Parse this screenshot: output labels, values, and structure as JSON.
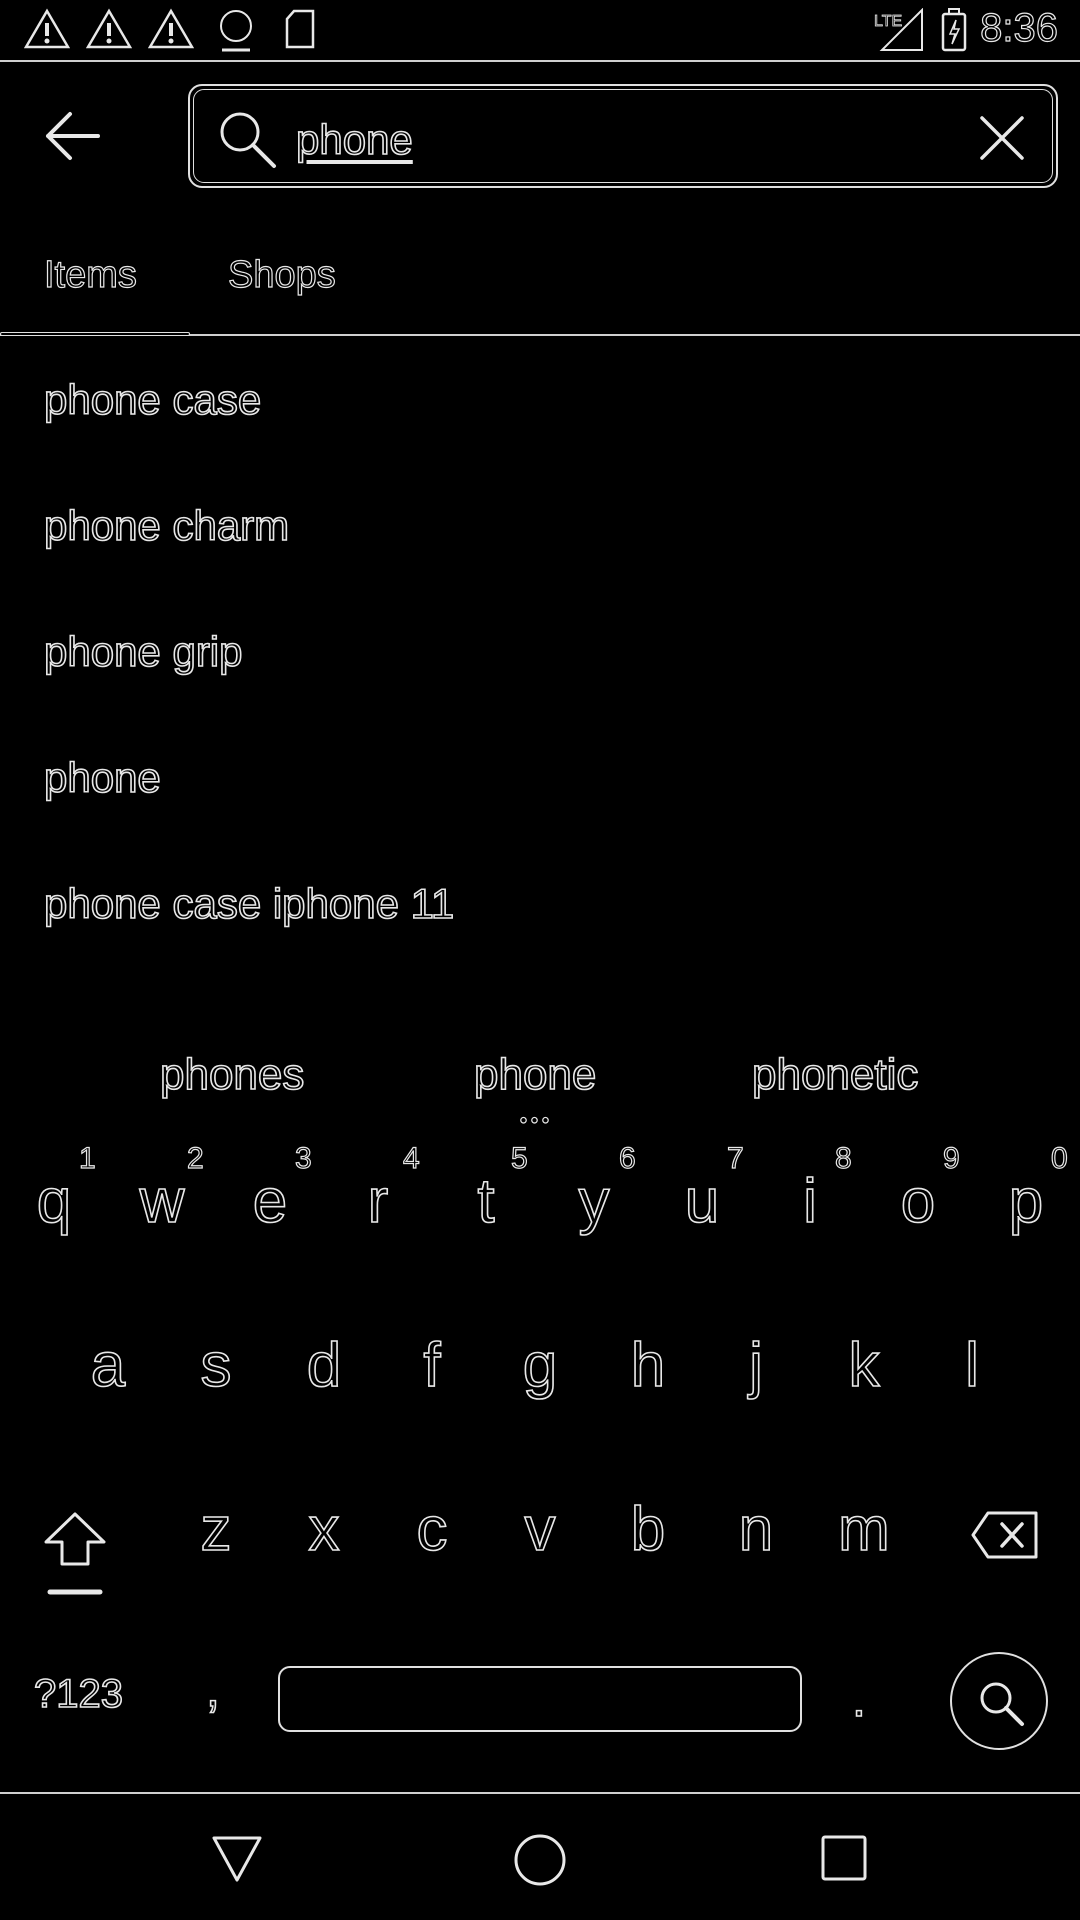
{
  "status_bar": {
    "icons": [
      "warning-icon",
      "warning-icon",
      "warning-icon",
      "abc-news-icon",
      "sd-card-icon",
      "lte-signal-icon",
      "battery-charging-icon"
    ],
    "network_label": "LTE",
    "time": "8:36"
  },
  "header": {
    "back_icon": "arrow-left-icon",
    "search_icon": "search-icon",
    "search_value": "phone",
    "clear_icon": "close-icon"
  },
  "tabs": [
    {
      "label": "Items",
      "selected": true
    },
    {
      "label": "Shops",
      "selected": false
    }
  ],
  "suggestions": [
    "phone case",
    "phone charm",
    "phone grip",
    "phone",
    "phone case iphone 11"
  ],
  "keyboard": {
    "candidates": [
      "phones",
      "phone",
      "phonetic"
    ],
    "candidate_more": "•••",
    "number_hints": [
      "1",
      "2",
      "3",
      "4",
      "5",
      "6",
      "7",
      "8",
      "9",
      "0"
    ],
    "row1": [
      "q",
      "w",
      "e",
      "r",
      "t",
      "y",
      "u",
      "i",
      "o",
      "p"
    ],
    "row2": [
      "a",
      "s",
      "d",
      "f",
      "g",
      "h",
      "j",
      "k",
      "l"
    ],
    "row3": [
      "z",
      "x",
      "c",
      "v",
      "b",
      "n",
      "m"
    ],
    "symbols_label": "?123",
    "comma_label": ",",
    "period_label": ".",
    "shift_icon": "shift-icon",
    "delete_icon": "backspace-icon",
    "action_icon": "search-icon"
  },
  "nav_bar": {
    "icons": [
      "back-triangle-icon",
      "home-circle-icon",
      "recents-square-icon"
    ]
  }
}
